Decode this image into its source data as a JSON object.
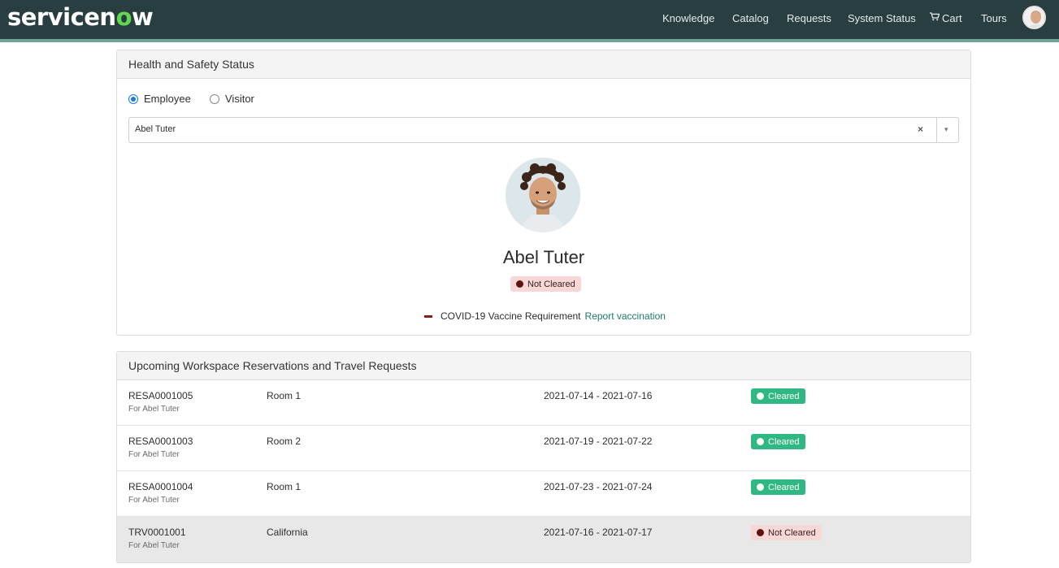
{
  "brand": {
    "logo_prefix": "servicen",
    "logo_o": "o",
    "logo_suffix": "w"
  },
  "nav": {
    "items": [
      "Knowledge",
      "Catalog",
      "Requests",
      "System Status",
      "Cart",
      "Tours"
    ],
    "cart_icon": "shopping-cart-icon"
  },
  "health_panel": {
    "title": "Health and Safety Status",
    "radio_employee": "Employee",
    "radio_visitor": "Visitor",
    "selected_radio": "Employee",
    "select_value": "Abel Tuter",
    "clear_glyph": "×",
    "dropdown_glyph": "▾",
    "person_name": "Abel Tuter",
    "status_label": "Not Cleared",
    "requirement_label": "COVID-19 Vaccine Requirement",
    "requirement_link": "Report vaccination"
  },
  "reservations_panel": {
    "title": "Upcoming Workspace Reservations and Travel Requests",
    "rows": [
      {
        "number": "RESA0001005",
        "for": "For Abel Tuter",
        "location": "Room 1",
        "dates": "2021-07-14 - 2021-07-16",
        "status": "Cleared"
      },
      {
        "number": "RESA0001003",
        "for": "For Abel Tuter",
        "location": "Room 2",
        "dates": "2021-07-19 - 2021-07-22",
        "status": "Cleared"
      },
      {
        "number": "RESA0001004",
        "for": "For Abel Tuter",
        "location": "Room 1",
        "dates": "2021-07-23 - 2021-07-24",
        "status": "Cleared"
      },
      {
        "number": "TRV0001001",
        "for": "For Abel Tuter",
        "location": "California",
        "dates": "2021-07-16 - 2021-07-17",
        "status": "Not Cleared"
      }
    ]
  },
  "colors": {
    "header_bg": "#293e40",
    "header_accent": "#6fa598",
    "logo_o": "#62d84e",
    "cleared": "#2fb784",
    "not_cleared_bg": "#f8d7d7",
    "not_cleared_dot": "#5e1212",
    "link": "#1d7a6b"
  }
}
